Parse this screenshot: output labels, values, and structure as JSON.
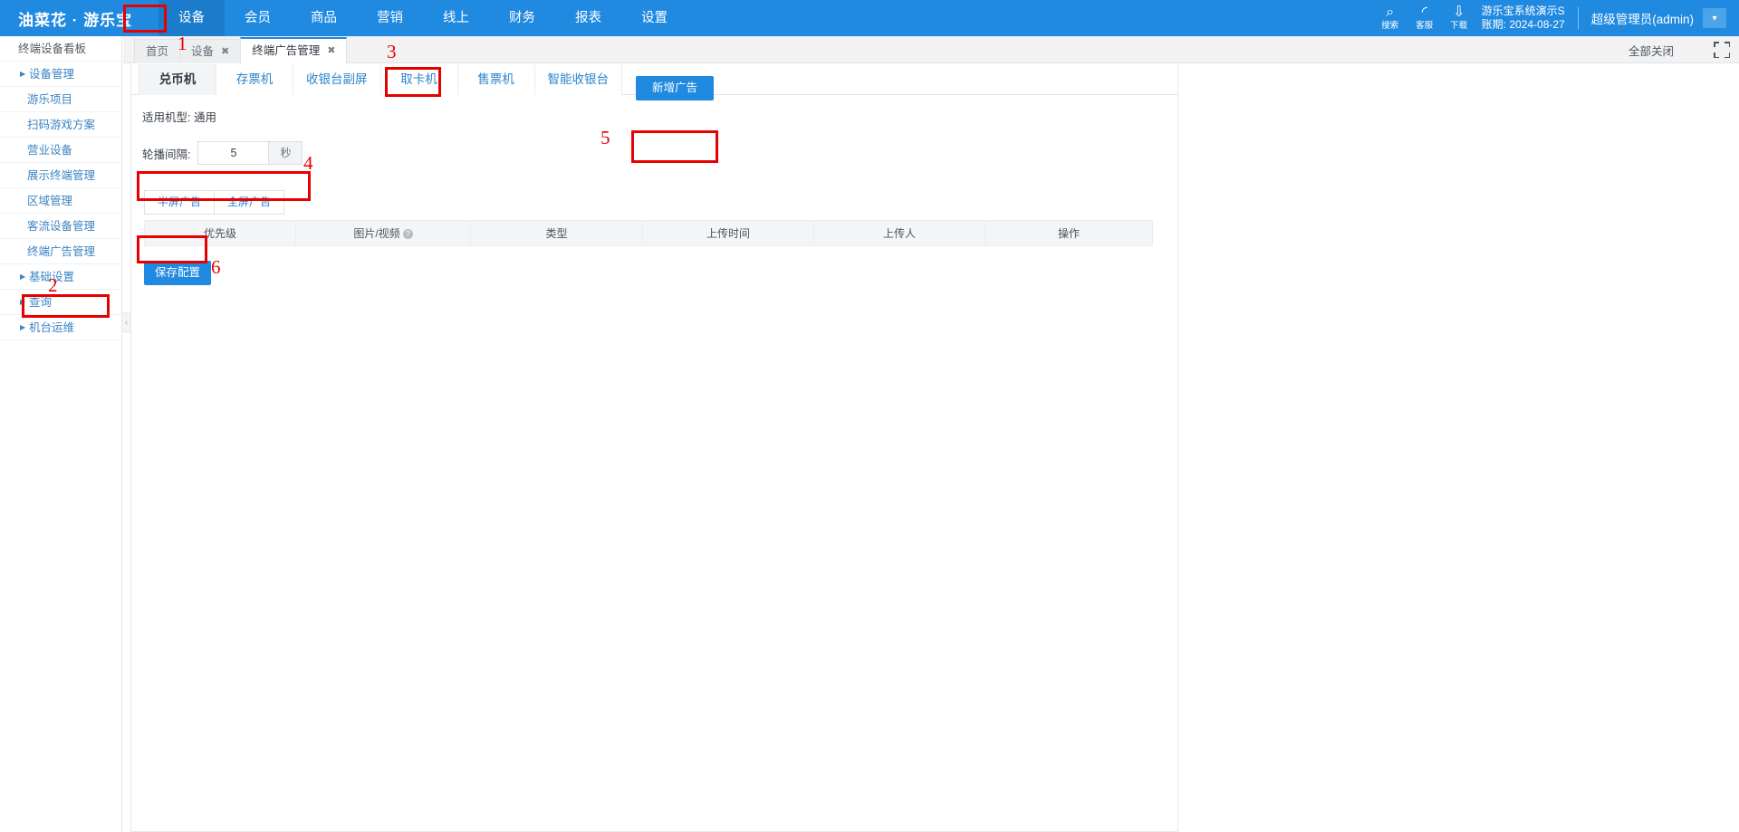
{
  "topnav": {
    "brand": "油菜花 · 游乐宝",
    "items": [
      {
        "label": "设备",
        "active": true
      },
      {
        "label": "会员",
        "active": false
      },
      {
        "label": "商品",
        "active": false
      },
      {
        "label": "营销",
        "active": false
      },
      {
        "label": "线上",
        "active": false
      },
      {
        "label": "财务",
        "active": false
      },
      {
        "label": "报表",
        "active": false
      },
      {
        "label": "设置",
        "active": false
      }
    ],
    "tools": [
      {
        "icon": "search-icon",
        "glyph": "⌕",
        "label": "搜索"
      },
      {
        "icon": "headset-icon",
        "glyph": "◜",
        "label": "客服"
      },
      {
        "icon": "download-icon",
        "glyph": "⇩",
        "label": "下载"
      }
    ],
    "account_name": "游乐宝系统演示S",
    "account_period": "账期: 2024-08-27",
    "user": "超级管理员(admin)",
    "caret": "▾"
  },
  "sidebar": {
    "items": [
      {
        "label": "终端设备看板",
        "type": "plain"
      },
      {
        "label": "设备管理",
        "type": "group",
        "arrow": "▶"
      },
      {
        "label": "游乐项目",
        "type": "sub"
      },
      {
        "label": "扫码游戏方案",
        "type": "sub"
      },
      {
        "label": "营业设备",
        "type": "sub"
      },
      {
        "label": "展示终端管理",
        "type": "sub"
      },
      {
        "label": "区域管理",
        "type": "sub"
      },
      {
        "label": "客流设备管理",
        "type": "sub"
      },
      {
        "label": "终端广告管理",
        "type": "sub",
        "highlighted": true
      },
      {
        "label": "基础设置",
        "type": "group",
        "arrow": "▶"
      },
      {
        "label": "查询",
        "type": "group",
        "arrow": "▶"
      },
      {
        "label": "机台运维",
        "type": "group",
        "arrow": "▶"
      }
    ],
    "collapse_glyph": "‹"
  },
  "tabstrip": {
    "tabs": [
      {
        "label": "首页",
        "closable": false,
        "active": false
      },
      {
        "label": "设备",
        "closable": true,
        "active": false
      },
      {
        "label": "终端广告管理",
        "closable": true,
        "active": true
      }
    ],
    "close_glyph": "✖",
    "close_all": "全部关闭"
  },
  "panel": {
    "device_tabs": [
      {
        "label": "兑币机",
        "active": true
      },
      {
        "label": "存票机",
        "active": false
      },
      {
        "label": "收银台副屏",
        "active": false
      },
      {
        "label": "取卡机",
        "active": false
      },
      {
        "label": "售票机",
        "active": false
      },
      {
        "label": "智能收银台",
        "active": false
      }
    ],
    "model_line": "适用机型: 通用",
    "interval_label": "轮播间隔:",
    "interval_value": "5",
    "interval_suffix": "秒",
    "interval_placeholder": "",
    "ad_mode_buttons": [
      {
        "label": "半屏广告",
        "active": true
      },
      {
        "label": "全屏广告",
        "active": false
      }
    ],
    "add_button": "新增广告",
    "save_button": "保存配置",
    "table": {
      "columns": [
        "优先级",
        "图片/视频",
        "类型",
        "上传时间",
        "上传人",
        "操作"
      ],
      "help_col_index": 1,
      "help_glyph": "?",
      "rows": []
    }
  },
  "annotations": {
    "marks": [
      {
        "num": "1"
      },
      {
        "num": "2"
      },
      {
        "num": "3"
      },
      {
        "num": "4"
      },
      {
        "num": "5"
      },
      {
        "num": "6"
      }
    ],
    "color": "#e60000"
  }
}
